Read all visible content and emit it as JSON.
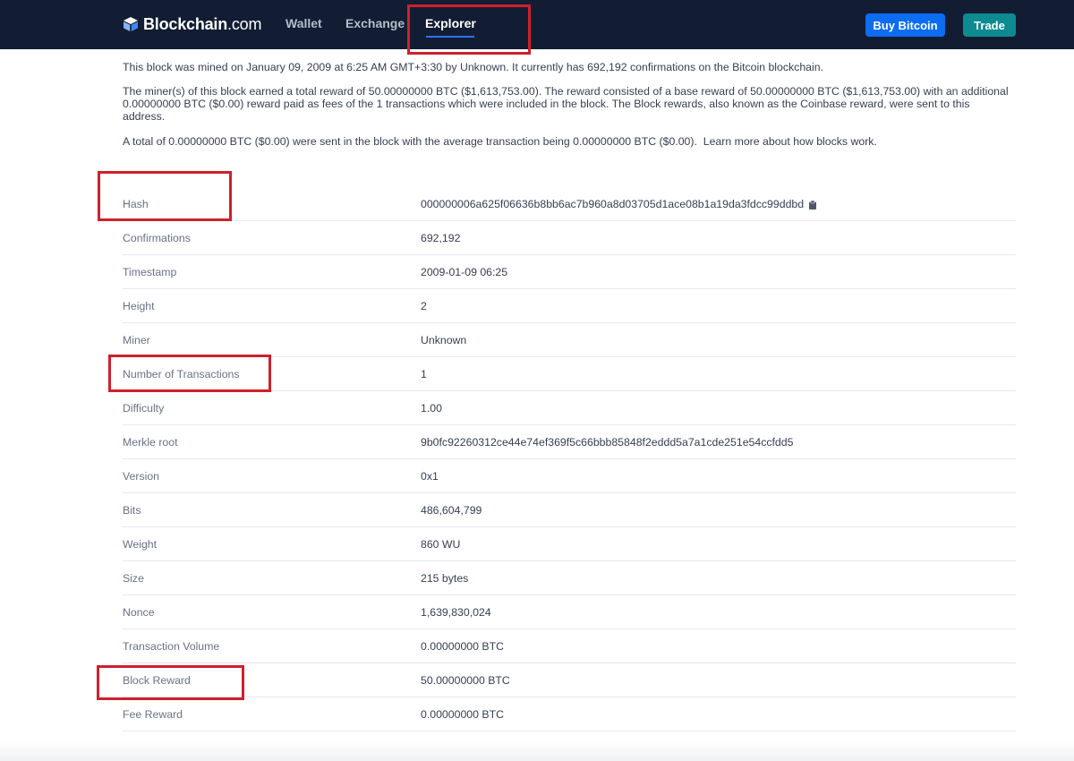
{
  "colors": {
    "nav_background": "#121d33",
    "buy_button": "#0c6cf2",
    "trade_button": "#0e8a91",
    "highlight_box": "#d0202c",
    "active_underline": "#2e74ed"
  },
  "header": {
    "logo_icon": "blockchain-cube-icon",
    "logo_name": "Blockchain",
    "logo_suffix": ".com",
    "nav": {
      "wallet": "Wallet",
      "exchange": "Exchange",
      "explorer": "Explorer"
    },
    "active_nav": "Explorer",
    "buy_button": "Buy Bitcoin",
    "trade_button": "Trade"
  },
  "intro": {
    "p1": "This block was mined on January 09, 2009 at 6:25 AM GMT+3:30 by Unknown. It currently has 692,192 confirmations on the Bitcoin blockchain.",
    "p2": "The miner(s) of this block earned a total reward of 50.00000000 BTC ($1,613,753.00). The reward consisted of a base reward of 50.00000000 BTC ($1,613,753.00) with an additional 0.00000000 BTC ($0.00) reward paid as fees of the 1 transactions which were included in the block. The Block rewards, also known as the Coinbase reward, were sent to this address.",
    "p3": "A total of 0.00000000 BTC ($0.00) were sent in the block with the average transaction being 0.00000000 BTC ($0.00).",
    "learn_more": "Learn more about how blocks work."
  },
  "details": [
    {
      "label": "Hash",
      "value": "000000006a625f06636b8bb6ac7b960a8d03705d1ace08b1a19da3fdcc99ddbd",
      "icon": "copy-icon"
    },
    {
      "label": "Confirmations",
      "value": "692,192"
    },
    {
      "label": "Timestamp",
      "value": "2009-01-09 06:25"
    },
    {
      "label": "Height",
      "value": "2"
    },
    {
      "label": "Miner",
      "value": "Unknown"
    },
    {
      "label": "Number of Transactions",
      "value": "1"
    },
    {
      "label": "Difficulty",
      "value": "1.00"
    },
    {
      "label": "Merkle root",
      "value": "9b0fc92260312ce44e74ef369f5c66bbb85848f2eddd5a7a1cde251e54ccfdd5"
    },
    {
      "label": "Version",
      "value": "0x1"
    },
    {
      "label": "Bits",
      "value": "486,604,799"
    },
    {
      "label": "Weight",
      "value": "860 WU"
    },
    {
      "label": "Size",
      "value": "215 bytes"
    },
    {
      "label": "Nonce",
      "value": "1,639,830,024"
    },
    {
      "label": "Transaction Volume",
      "value": "0.00000000 BTC"
    },
    {
      "label": "Block Reward",
      "value": "50.00000000 BTC"
    },
    {
      "label": "Fee Reward",
      "value": "0.00000000 BTC"
    }
  ]
}
